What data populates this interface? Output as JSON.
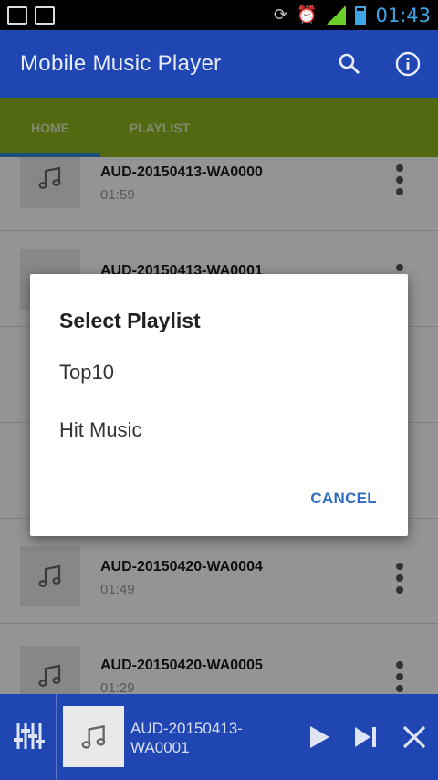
{
  "status_bar": {
    "time": "01:43"
  },
  "app_bar": {
    "title": "Mobile Music Player",
    "search_icon": "search-icon",
    "info_icon": "info-icon"
  },
  "tabs": [
    {
      "label": "HOME"
    },
    {
      "label": "PLAYLIST"
    }
  ],
  "songs": [
    {
      "title": "AUD-20150413-WA0000",
      "duration": "01:59"
    },
    {
      "title": "AUD-20150413-WA0001",
      "duration": ""
    },
    {
      "title": "",
      "duration": ""
    },
    {
      "title": "",
      "duration": ""
    },
    {
      "title": "AUD-20150420-WA0004",
      "duration": "01:49"
    },
    {
      "title": "AUD-20150420-WA0005",
      "duration": "01:29"
    }
  ],
  "dialog": {
    "title": "Select Playlist",
    "items": [
      {
        "label": "Top10"
      },
      {
        "label": "Hit Music"
      }
    ],
    "cancel_label": "CANCEL"
  },
  "player": {
    "now_playing": "AUD-20150413-WA0001",
    "controls": [
      "equalizer-icon",
      "play-icon",
      "skip-next-icon",
      "close-icon"
    ]
  },
  "colors": {
    "app_bar": "#2046b4",
    "tab_bar": "#8eb51f",
    "tab_indicator": "#2f8ad8",
    "accent_text": "#2d6cc0"
  }
}
